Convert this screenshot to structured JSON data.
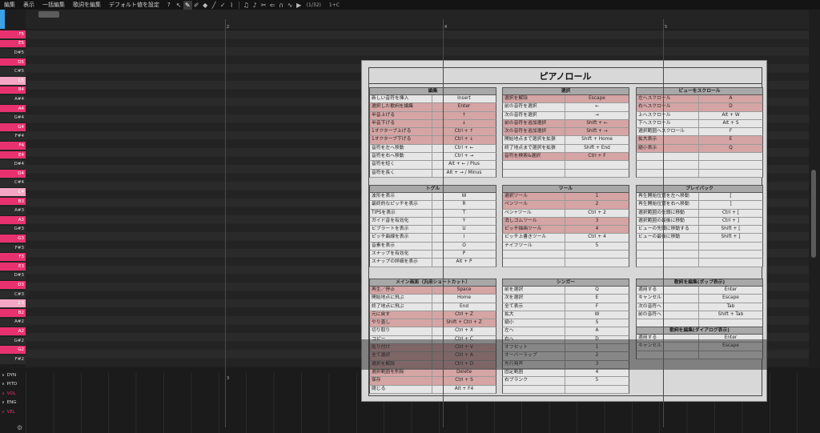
{
  "menu": {
    "items": [
      "編集",
      "表示",
      "一括編集",
      "歌詞を編集",
      "デフォルト値を設定"
    ],
    "help": "?",
    "page_indicator": "(1/32)",
    "extra": "1+C"
  },
  "toolbar": {
    "tools": [
      "cursor-icon",
      "pencil-icon",
      "note-brush-icon",
      "eraser-icon",
      "line-pencil-icon",
      "pitch-brush-icon",
      "knife-icon",
      "music-note-icon",
      "triplet-icon",
      "scissors-icon",
      "arrow-left-icon",
      "curve-icon",
      "wave-icon",
      "play-icon"
    ]
  },
  "ruler": {
    "measures": [
      "2",
      "4",
      "5"
    ],
    "lower_measure": "3"
  },
  "piano_keys": [
    {
      "label": "F5",
      "style": "pink"
    },
    {
      "label": "E5",
      "style": "pink"
    },
    {
      "label": "D#5",
      "style": "gray"
    },
    {
      "label": "D5",
      "style": "pink"
    },
    {
      "label": "C#5",
      "style": "gray"
    },
    {
      "label": "C5",
      "style": "lt"
    },
    {
      "label": "B4",
      "style": "pink"
    },
    {
      "label": "A#4",
      "style": "gray"
    },
    {
      "label": "A4",
      "style": "pink"
    },
    {
      "label": "G#4",
      "style": "gray"
    },
    {
      "label": "G4",
      "style": "pink"
    },
    {
      "label": "F#4",
      "style": "gray"
    },
    {
      "label": "F4",
      "style": "pink"
    },
    {
      "label": "E4",
      "style": "pink"
    },
    {
      "label": "D#4",
      "style": "gray"
    },
    {
      "label": "D4",
      "style": "pink"
    },
    {
      "label": "C#4",
      "style": "gray"
    },
    {
      "label": "C4",
      "style": "lt"
    },
    {
      "label": "B3",
      "style": "pink"
    },
    {
      "label": "A#3",
      "style": "gray"
    },
    {
      "label": "A3",
      "style": "pink"
    },
    {
      "label": "G#3",
      "style": "gray"
    },
    {
      "label": "G3",
      "style": "pink"
    },
    {
      "label": "F#3",
      "style": "gray"
    },
    {
      "label": "F3",
      "style": "pink"
    },
    {
      "label": "E3",
      "style": "pink"
    },
    {
      "label": "D#3",
      "style": "gray"
    },
    {
      "label": "D3",
      "style": "pink"
    },
    {
      "label": "C#3",
      "style": "gray"
    },
    {
      "label": "C3",
      "style": "lt"
    },
    {
      "label": "B2",
      "style": "pink"
    },
    {
      "label": "A#2",
      "style": "gray"
    },
    {
      "label": "A2",
      "style": "pink"
    },
    {
      "label": "G#2",
      "style": "gray"
    },
    {
      "label": "G2",
      "style": "pink"
    },
    {
      "label": "F#2",
      "style": "gray"
    }
  ],
  "params": [
    {
      "label": "DYN",
      "active": false
    },
    {
      "label": "PITD",
      "active": false
    },
    {
      "label": "VOL",
      "active": true
    },
    {
      "label": "ENG",
      "active": false
    },
    {
      "label": "VEL",
      "active": true
    }
  ],
  "shortcuts": {
    "title": "ピアノロール",
    "edit": {
      "header": "編集",
      "rows": [
        [
          "新しい音符を挿入",
          "Insert"
        ],
        [
          "選択した歌詞を編集",
          "Enter"
        ],
        [
          "半音上げる",
          "↑"
        ],
        [
          "半音下げる",
          "↓"
        ],
        [
          "1オクターブ上げる",
          "Ctrl + ↑"
        ],
        [
          "1オクターブ下げる",
          "Ctrl + ↓"
        ],
        [
          "音符を左へ移動",
          "Ctrl + ←"
        ],
        [
          "音符を右へ移動",
          "Ctrl + →"
        ],
        [
          "音符を短く",
          "Alt + ← / Plus"
        ],
        [
          "音符を長く",
          "Alt + → / Minus"
        ]
      ]
    },
    "selection": {
      "header": "選択",
      "rows": [
        [
          "選択を解除",
          "Escape"
        ],
        [
          "前の音符を選択",
          "←"
        ],
        [
          "次の音符を選択",
          "→"
        ],
        [
          "前の音符を追加選択",
          "Shift + ←"
        ],
        [
          "次の音符を追加選択",
          "Shift + →"
        ],
        [
          "開始地点まで選択を拡張",
          "Shift + Home"
        ],
        [
          "終了地点まで選択を拡張",
          "Shift + End"
        ],
        [
          "音符を検索&選択",
          "Ctrl + F"
        ]
      ]
    },
    "scroll": {
      "header": "ビューをスクロール",
      "rows": [
        [
          "左へスクロール",
          "A"
        ],
        [
          "右へスクロール",
          "D"
        ],
        [
          "上へスクロール",
          "Alt + W"
        ],
        [
          "下へスクロール",
          "Alt + S"
        ],
        [
          "選択範囲へスクロール",
          "F"
        ],
        [
          "拡大表示",
          "E"
        ],
        [
          "縮小表示",
          "Q"
        ]
      ]
    },
    "toggle": {
      "header": "トグル",
      "rows": [
        [
          "波形を表示",
          "W"
        ],
        [
          "最終的なピッチを表示",
          "R"
        ],
        [
          "TIPSを表示",
          "T"
        ],
        [
          "ガイド音を有効化",
          "Y"
        ],
        [
          "ビブラートを表示",
          "U"
        ],
        [
          "ピッチ曲線を表示",
          "I"
        ],
        [
          "音素を表示",
          "O"
        ],
        [
          "スナップを有効化",
          "P"
        ],
        [
          "スナップの詳細を表示",
          "Alt + P"
        ]
      ]
    },
    "tools": {
      "header": "ツール",
      "rows": [
        [
          "選択ツール",
          "1"
        ],
        [
          "ペンツール",
          "2"
        ],
        [
          "ペン+ツール",
          "Ctrl + 2"
        ],
        [
          "消しゴムツール",
          "3"
        ],
        [
          "ピッチ描画ツール",
          "4"
        ],
        [
          "ピッチ上書きツール",
          "Ctrl + 4"
        ],
        [
          "ナイフツール",
          "5"
        ]
      ]
    },
    "playback": {
      "header": "プレイバック",
      "rows": [
        [
          "再生開始位置を左へ移動",
          "["
        ],
        [
          "再生開始位置を右へ移動",
          "]"
        ],
        [
          "選択範囲の先頭に移動",
          "Ctrl + ["
        ],
        [
          "選択範囲の最後に移動",
          "Ctrl + ]"
        ],
        [
          "ビューの先頭に移動する",
          "Shift + ["
        ],
        [
          "ビューの最後に移動",
          "Shift + ]"
        ]
      ]
    },
    "main": {
      "header": "メイン画面（汎用ショートカット）",
      "rows": [
        [
          "再生／停止",
          "Space"
        ],
        [
          "開始地点に飛ぶ",
          "Home"
        ],
        [
          "終了地点に飛ぶ",
          "End"
        ],
        [
          "元に戻す",
          "Ctrl + Z"
        ],
        [
          "やり直し",
          "Shift + Ctrl + Z"
        ],
        [
          "切り取り",
          "Ctrl + X"
        ],
        [
          "コピー",
          "Ctrl + C"
        ],
        [
          "貼り付け",
          "Ctrl + V"
        ],
        [
          "全て選択",
          "Ctrl + A"
        ],
        [
          "選択を解除",
          "Ctrl + D"
        ],
        [
          "選択範囲を削除",
          "Delete"
        ],
        [
          "保存",
          "Ctrl + S"
        ],
        [
          "閉じる",
          "Alt + F4"
        ]
      ]
    },
    "singer": {
      "header": "シンガー",
      "rows": [
        [
          "前を選択",
          "Q"
        ],
        [
          "次を選択",
          "E"
        ],
        [
          "全て表示",
          "F"
        ],
        [
          "拡大",
          "W"
        ],
        [
          "縮小",
          "S"
        ],
        [
          "左へ",
          "A"
        ],
        [
          "右へ",
          "D"
        ],
        [
          "オフセット",
          "1"
        ],
        [
          "オーバーラップ",
          "2"
        ],
        [
          "先行発声",
          "3"
        ],
        [
          "固定範囲",
          "4"
        ],
        [
          "右ブランク",
          "5"
        ]
      ]
    },
    "lyrics_popup": {
      "header": "歌詞を編集(ポップ表示)",
      "rows": [
        [
          "適用する",
          "Enter"
        ],
        [
          "キャンセル",
          "Escape"
        ],
        [
          "次の音符へ",
          "Tab"
        ],
        [
          "前の音符へ",
          "Shift + Tab"
        ]
      ]
    },
    "lyrics_dialog": {
      "header": "歌詞を編集(ダイアログ表示)",
      "rows": [
        [
          "適用する",
          "Enter"
        ],
        [
          "キャンセル",
          "Escape"
        ]
      ]
    }
  }
}
